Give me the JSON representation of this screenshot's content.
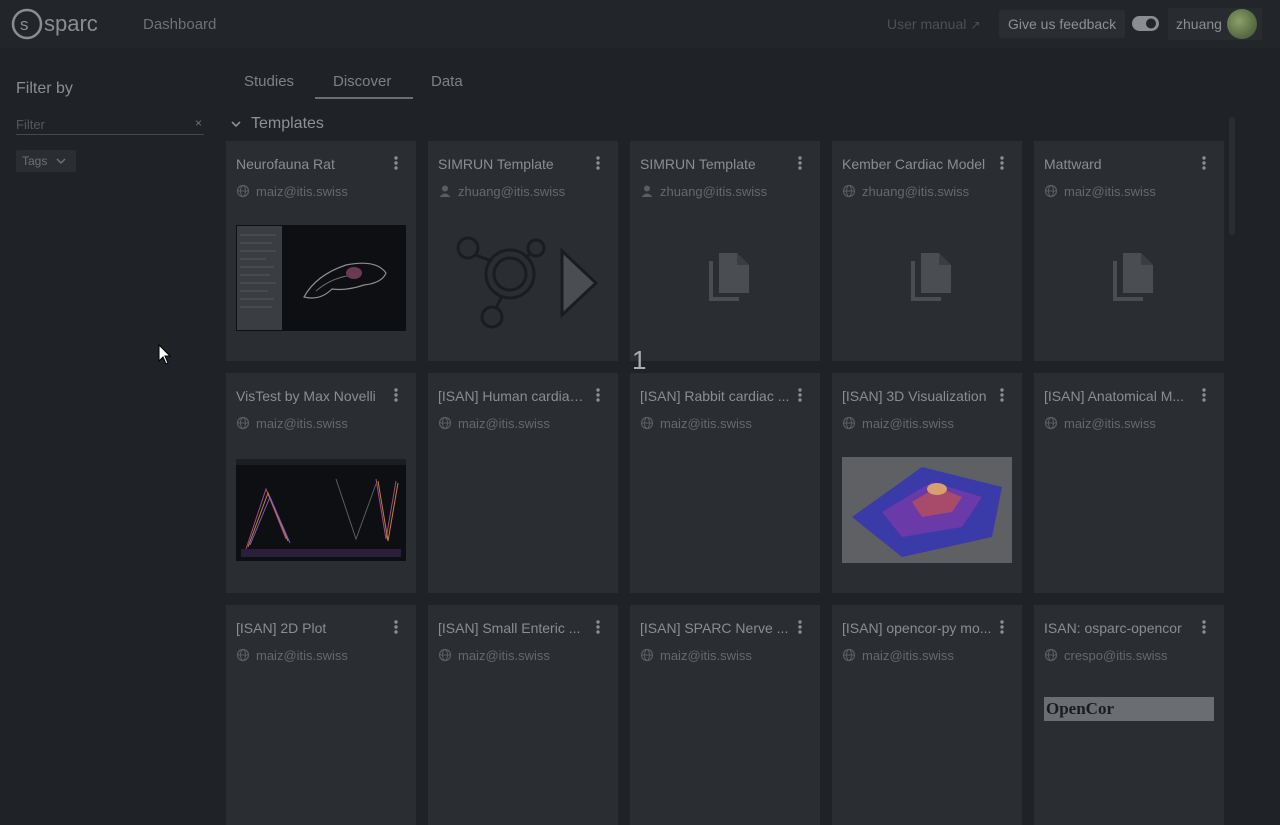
{
  "header": {
    "logo_text": "sparc",
    "title": "Dashboard",
    "user_manual": "User manual",
    "feedback": "Give us feedback",
    "username": "zhuang"
  },
  "sidebar": {
    "title": "Filter by",
    "filter_placeholder": "Filter",
    "clear_icon": "×",
    "tags_label": "Tags"
  },
  "tabs": [
    {
      "label": "Studies",
      "active": false
    },
    {
      "label": "Discover",
      "active": true
    },
    {
      "label": "Data",
      "active": false
    }
  ],
  "section": {
    "title": "Templates"
  },
  "cards": [
    {
      "title": "Neurofauna Rat",
      "owner": "maiz@itis.swiss",
      "owner_icon": "globe-icon",
      "thumb": "rat-screenshot"
    },
    {
      "title": "SIMRUN Template",
      "owner": "zhuang@itis.swiss",
      "owner_icon": "user-icon",
      "thumb": "simrun-logo"
    },
    {
      "title": "SIMRUN Template",
      "owner": "zhuang@itis.swiss",
      "owner_icon": "user-icon",
      "thumb": "copy-icon"
    },
    {
      "title": "Kember Cardiac Model",
      "owner": "zhuang@itis.swiss",
      "owner_icon": "globe-icon",
      "thumb": "copy-icon"
    },
    {
      "title": "Mattward",
      "owner": "maiz@itis.swiss",
      "owner_icon": "globe-icon",
      "thumb": "copy-icon"
    },
    {
      "title": "VisTest by Max Novelli",
      "owner": "maiz@itis.swiss",
      "owner_icon": "globe-icon",
      "thumb": "vistest-plot"
    },
    {
      "title": "[ISAN] Human cardiac ...",
      "owner": "maiz@itis.swiss",
      "owner_icon": "globe-icon",
      "thumb": "none"
    },
    {
      "title": "[ISAN] Rabbit cardiac ...",
      "owner": "maiz@itis.swiss",
      "owner_icon": "globe-icon",
      "thumb": "none"
    },
    {
      "title": "[ISAN] 3D Visualization",
      "owner": "maiz@itis.swiss",
      "owner_icon": "globe-icon",
      "thumb": "surface-3d"
    },
    {
      "title": "[ISAN] Anatomical M...",
      "owner": "maiz@itis.swiss",
      "owner_icon": "globe-icon",
      "thumb": "none"
    },
    {
      "title": "[ISAN] 2D Plot",
      "owner": "maiz@itis.swiss",
      "owner_icon": "globe-icon",
      "thumb": "none"
    },
    {
      "title": "[ISAN] Small Enteric ...",
      "owner": "maiz@itis.swiss",
      "owner_icon": "globe-icon",
      "thumb": "none"
    },
    {
      "title": "[ISAN] SPARC Nerve ...",
      "owner": "maiz@itis.swiss",
      "owner_icon": "globe-icon",
      "thumb": "none"
    },
    {
      "title": "[ISAN] opencor-py mo...",
      "owner": "maiz@itis.swiss",
      "owner_icon": "globe-icon",
      "thumb": "none"
    },
    {
      "title": "ISAN: osparc-opencor",
      "owner": "crespo@itis.swiss",
      "owner_icon": "globe-icon",
      "thumb": "opencor-logo"
    }
  ],
  "opencor_logo_text": "OpenCor",
  "overlay_number": "1"
}
